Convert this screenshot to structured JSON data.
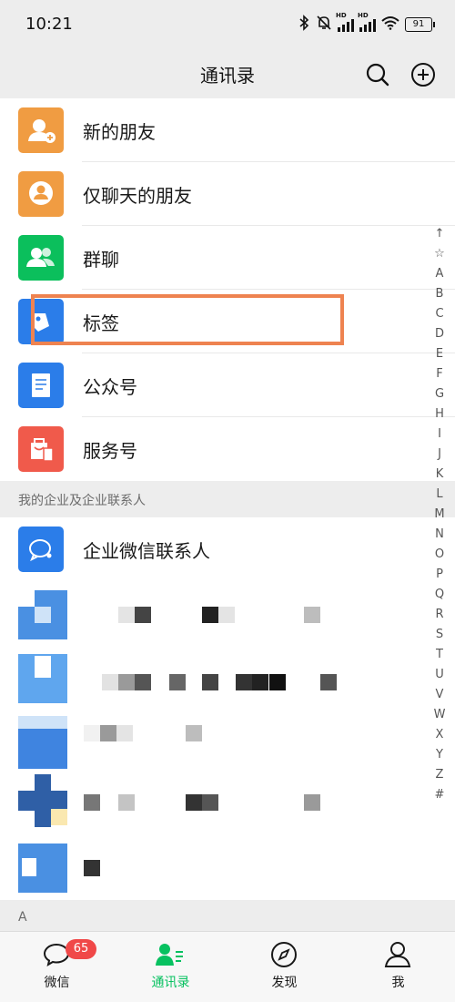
{
  "status_bar": {
    "time": "10:21",
    "battery": "91",
    "signal_label": "HD"
  },
  "header": {
    "title": "通讯录"
  },
  "contacts_top": [
    {
      "label": "新的朋友",
      "icon": "add-friend-icon",
      "color": "#f09c42"
    },
    {
      "label": "仅聊天的朋友",
      "icon": "chat-only-friend-icon",
      "color": "#f09c42"
    },
    {
      "label": "群聊",
      "icon": "group-chat-icon",
      "color": "#0bbf5c"
    },
    {
      "label": "标签",
      "icon": "tag-icon",
      "color": "#2b7de9"
    },
    {
      "label": "公众号",
      "icon": "official-account-icon",
      "color": "#2b7de9"
    },
    {
      "label": "服务号",
      "icon": "service-account-icon",
      "color": "#f05a4b"
    }
  ],
  "section_enterprise": "我的企业及企业联系人",
  "enterprise_row": {
    "label": "企业微信联系人",
    "icon": "wecom-contacts-icon",
    "color": "#2b7de9"
  },
  "section_a": "A",
  "index_letters": [
    "↑",
    "☆",
    "A",
    "B",
    "C",
    "D",
    "E",
    "F",
    "G",
    "H",
    "I",
    "J",
    "K",
    "L",
    "M",
    "N",
    "O",
    "P",
    "Q",
    "R",
    "S",
    "T",
    "U",
    "V",
    "W",
    "X",
    "Y",
    "Z",
    "#"
  ],
  "tabs": [
    {
      "label": "微信",
      "icon": "chat-bubble-icon",
      "badge": "65"
    },
    {
      "label": "通讯录",
      "icon": "contacts-icon",
      "active": true
    },
    {
      "label": "发现",
      "icon": "compass-icon"
    },
    {
      "label": "我",
      "icon": "person-icon"
    }
  ],
  "colors": {
    "accent": "#07c160",
    "highlight_box": "#ee8350",
    "badge": "#f04848"
  }
}
